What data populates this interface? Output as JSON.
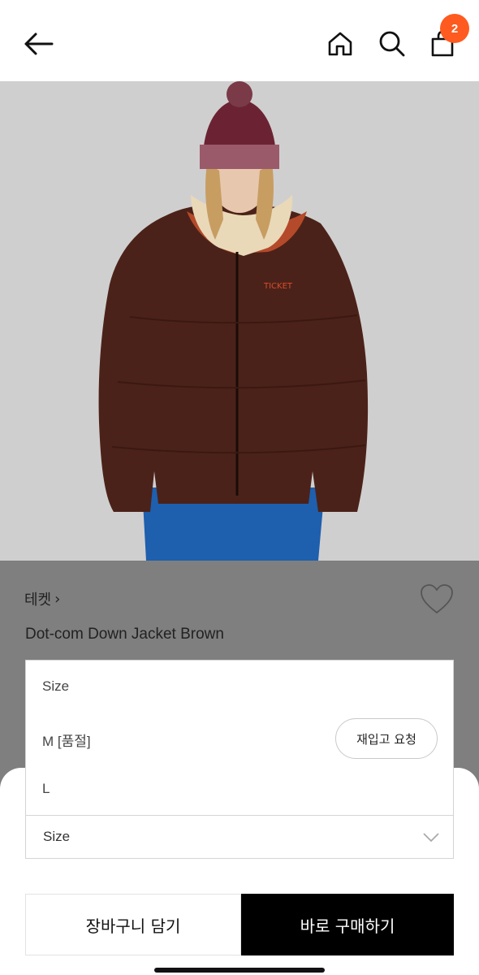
{
  "header": {
    "back_icon": "arrow-left-icon",
    "home_icon": "home-icon",
    "search_icon": "search-icon",
    "cart_icon": "shopping-bag-icon",
    "cart_count": "2",
    "badge_color": "#ff5a1f"
  },
  "product": {
    "photo_icon": "product-photo",
    "brand": "테켓",
    "brand_chevron": "›",
    "name": "Dot-com Down Jacket Brown",
    "wishlist_icon": "heart-icon"
  },
  "size_dropdown": {
    "title": "Size",
    "options": [
      {
        "label": "M [품절]"
      },
      {
        "label": "L"
      }
    ],
    "restock_button": "재입고 요청"
  },
  "size_select": {
    "label": "Size",
    "icon": "chevron-down-icon"
  },
  "actions": {
    "add_to_cart": "장바구니 담기",
    "buy_now": "바로 구매하기"
  }
}
